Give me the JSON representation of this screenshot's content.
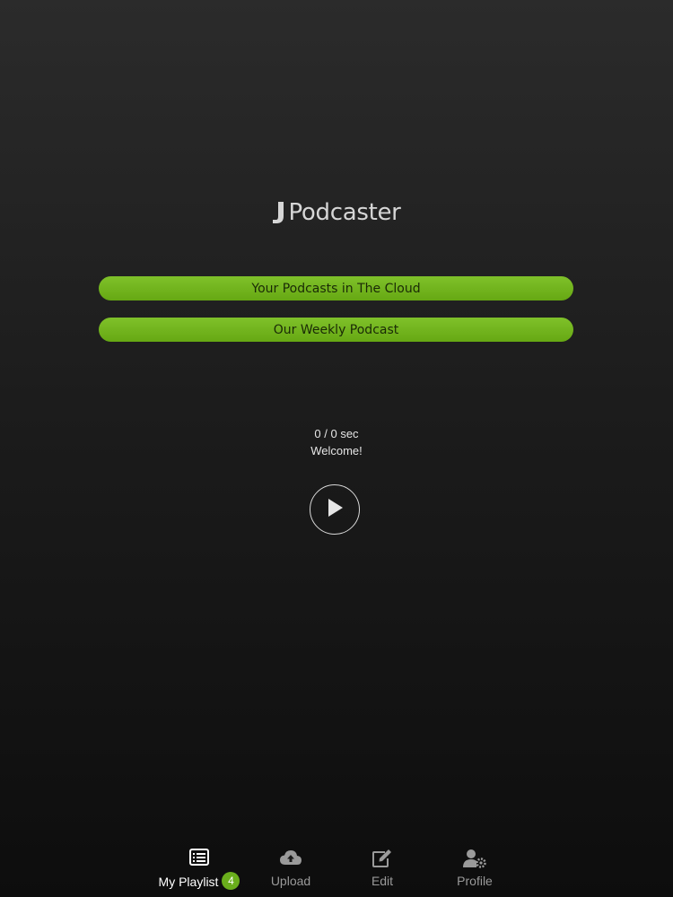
{
  "app": {
    "title": "Podcaster",
    "icons": {
      "logo": "j-note-logo-icon"
    }
  },
  "links": [
    {
      "label": "Your Podcasts in The Cloud"
    },
    {
      "label": "Our Weekly Podcast"
    }
  ],
  "player": {
    "time_text": "0 / 0 sec",
    "status_text": "Welcome!",
    "play_icon": "play-icon"
  },
  "tabbar": {
    "items": [
      {
        "label": "My Playlist",
        "icon": "list-icon",
        "badge": "4",
        "active": true
      },
      {
        "label": "Upload",
        "icon": "cloud-upload-icon",
        "active": false
      },
      {
        "label": "Edit",
        "icon": "edit-icon",
        "active": false
      },
      {
        "label": "Profile",
        "icon": "user-settings-icon",
        "active": false
      }
    ]
  },
  "colors": {
    "accent": "#6aae1c",
    "background_top": "#2b2b2b",
    "background_bottom": "#0d0d0d"
  }
}
